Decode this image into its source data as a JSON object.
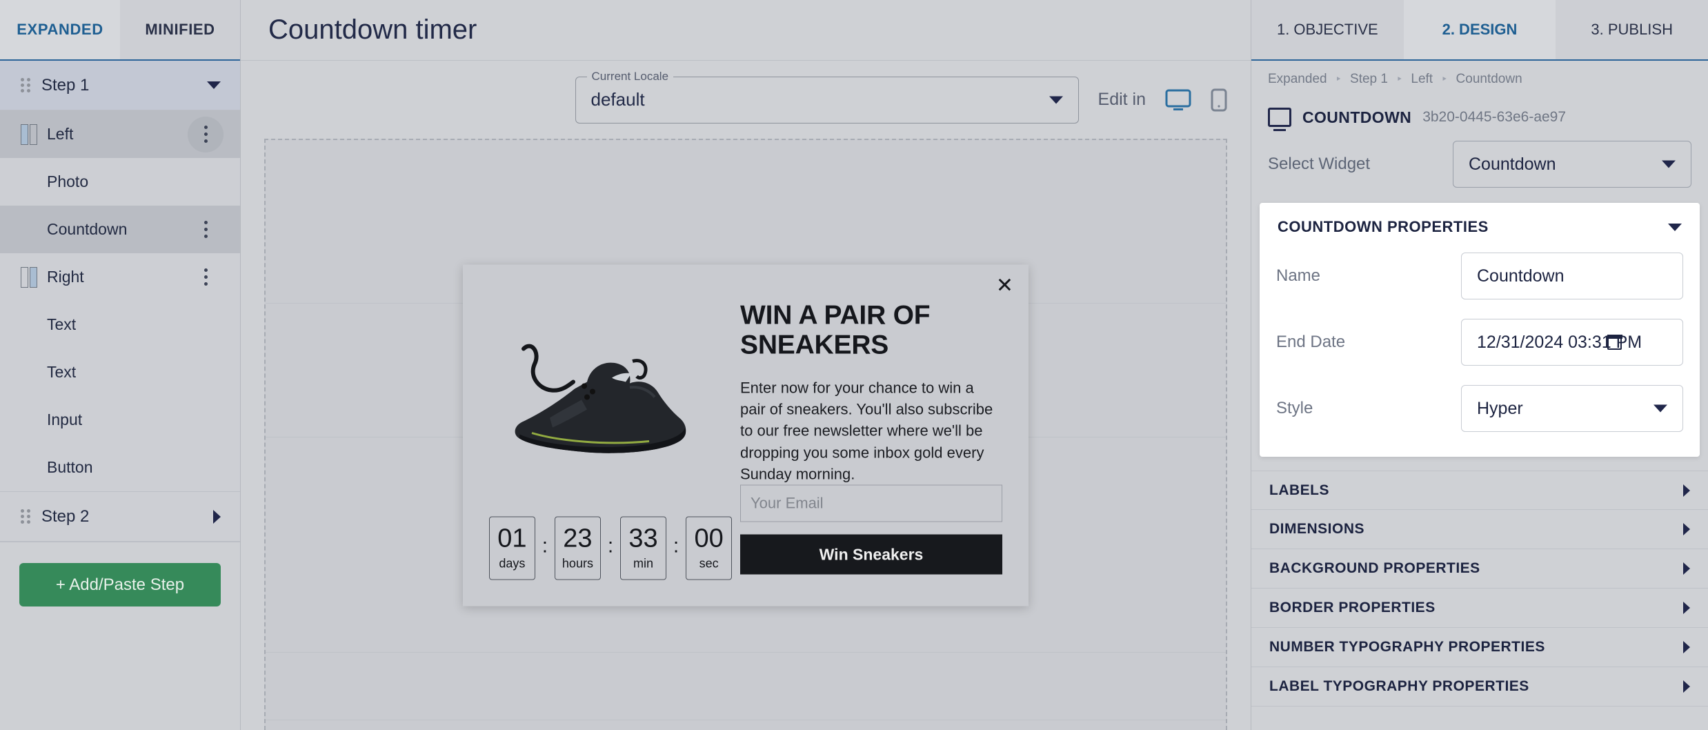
{
  "sidebar": {
    "tabs": [
      {
        "label": "EXPANDED",
        "active": true
      },
      {
        "label": "MINIFIED",
        "active": false
      }
    ],
    "steps": [
      {
        "label": "Step 1",
        "expanded": true
      },
      {
        "label": "Step 2",
        "expanded": false
      }
    ],
    "layers": [
      {
        "label": "Left",
        "type": "column-left",
        "selected": true,
        "kebab": "circle"
      },
      {
        "label": "Photo",
        "type": "child",
        "selected": false,
        "kebab": "none"
      },
      {
        "label": "Countdown",
        "type": "child",
        "selected": true,
        "kebab": "plain"
      },
      {
        "label": "Right",
        "type": "column-right",
        "selected": false,
        "kebab": "plain"
      },
      {
        "label": "Text",
        "type": "child",
        "selected": false,
        "kebab": "none"
      },
      {
        "label": "Text",
        "type": "child",
        "selected": false,
        "kebab": "none"
      },
      {
        "label": "Input",
        "type": "child",
        "selected": false,
        "kebab": "none"
      },
      {
        "label": "Button",
        "type": "child",
        "selected": false,
        "kebab": "none"
      }
    ],
    "add_step_label": "+ Add/Paste Step"
  },
  "center": {
    "title": "Countdown timer",
    "locale": {
      "legend": "Current Locale",
      "value": "default"
    },
    "edit_in_label": "Edit in",
    "devices": [
      {
        "name": "desktop-icon",
        "active": true
      },
      {
        "name": "mobile-icon",
        "active": false
      }
    ]
  },
  "modal": {
    "close_label": "✕",
    "headline": "WIN A PAIR OF SNEAKERS",
    "body": "Enter now for your chance to win a pair of sneakers. You'll also subscribe to our free newsletter where we'll be dropping you some inbox gold every Sunday morning.",
    "email_placeholder": "Your Email",
    "submit_label": "Win Sneakers",
    "timer": [
      {
        "value": "01",
        "unit": "days"
      },
      {
        "value": "23",
        "unit": "hours"
      },
      {
        "value": "33",
        "unit": "min"
      },
      {
        "value": "00",
        "unit": "sec"
      }
    ],
    "separator": ":"
  },
  "right_panel": {
    "tabs": [
      {
        "label": "1. OBJECTIVE",
        "active": false
      },
      {
        "label": "2. DESIGN",
        "active": true
      },
      {
        "label": "3. PUBLISH",
        "active": false
      }
    ],
    "breadcrumb": [
      "Expanded",
      "Step 1",
      "Left",
      "Countdown"
    ],
    "breadcrumb_separator": "‣",
    "widget": {
      "title": "COUNTDOWN",
      "id": "3b20-0445-63e6-ae97",
      "select_widget_label": "Select Widget",
      "select_widget_value": "Countdown"
    },
    "properties": {
      "header": "COUNTDOWN PROPERTIES",
      "name_label": "Name",
      "name_value": "Countdown",
      "end_date_label": "End Date",
      "end_date_value": "12/31/2024  03:31  PM",
      "style_label": "Style",
      "style_value": "Hyper"
    },
    "sections": [
      "LABELS",
      "DIMENSIONS",
      "BACKGROUND PROPERTIES",
      "BORDER PROPERTIES",
      "NUMBER TYPOGRAPHY PROPERTIES",
      "LABEL TYPOGRAPHY PROPERTIES"
    ]
  },
  "colors": {
    "accent_blue": "#1f5f92",
    "green_button": "#368a5a",
    "app_bg": "#cfd1d5",
    "dark_button": "#17191d"
  }
}
